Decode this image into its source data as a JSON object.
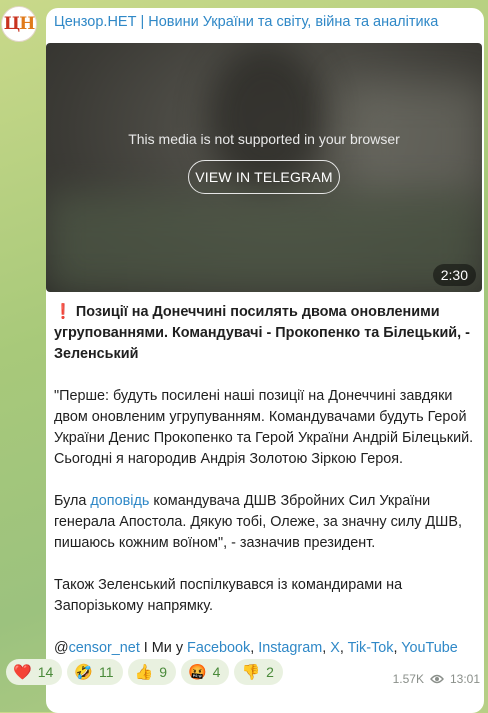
{
  "channel": {
    "avatar_letters": [
      "Ц",
      "Н"
    ],
    "title": "Цензор.НЕТ | Новини України та світу, війна та аналітика"
  },
  "media": {
    "message": "This media is not supported in your browser",
    "button": "VIEW IN TELEGRAM",
    "duration": "2:30"
  },
  "post": {
    "headline_marker": "❗",
    "headline": "Позиції на Донеччині посилять двома оновленими угрупованнями. Командувачі - Прокопенко та Білецький, - Зеленський",
    "para1": "\"Перше: будуть посилені наші позиції на Донеччині завдяки двом оновленим угрупуванням. Командувачами будуть Герой України Денис Прокопенко та Герой України Андрій Білецький. Сьогодні я нагородив Андрія Золотою Зіркою Героя.",
    "para2_before": "Була ",
    "para2_link": "доповідь",
    "para2_after": " командувача ДШВ Збройних Сил України генерала Апостола. Дякую тобі, Олеже, за значну силу ДШВ, пишаюсь кожним воїном\", - зазначив президент.",
    "para3": "Також Зеленський поспілкувався із командирами на Запорізькому напрямку.",
    "footer": {
      "at": "@",
      "handle": "censor_net",
      "mid": " І Ми у ",
      "links": [
        "Facebook",
        "Instagram",
        "X",
        "Tik-Tok",
        "YouTube"
      ],
      "sep": ", "
    }
  },
  "reactions": [
    {
      "emoji": "❤️",
      "count": "14"
    },
    {
      "emoji": "🤣",
      "count": "11"
    },
    {
      "emoji": "👍",
      "count": "9"
    },
    {
      "emoji": "🤬",
      "count": "4"
    },
    {
      "emoji": "👎",
      "count": "2"
    }
  ],
  "meta": {
    "views": "1.57K",
    "time": "13:01"
  }
}
